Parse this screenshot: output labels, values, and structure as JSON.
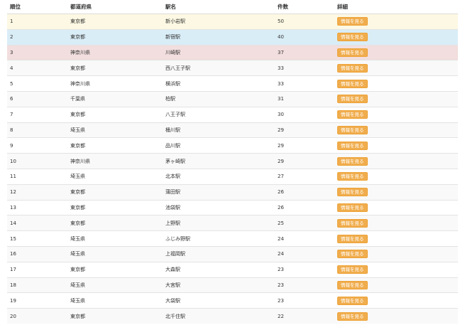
{
  "headers": {
    "rank": "順位",
    "prefecture": "都道府県",
    "station": "駅名",
    "count": "件数",
    "detail": "詳細"
  },
  "button_label": "情報を見る",
  "colors": {
    "rank1_bg": "#fcf8e3",
    "rank2_bg": "#d9edf7",
    "rank3_bg": "#f2dede",
    "button_bg": "#f0ad4e"
  },
  "rows": [
    {
      "rank": "1",
      "prefecture": "東京都",
      "station": "新小岩駅",
      "count": "50"
    },
    {
      "rank": "2",
      "prefecture": "東京都",
      "station": "新宿駅",
      "count": "40"
    },
    {
      "rank": "3",
      "prefecture": "神奈川県",
      "station": "川崎駅",
      "count": "37"
    },
    {
      "rank": "4",
      "prefecture": "東京都",
      "station": "西八王子駅",
      "count": "33"
    },
    {
      "rank": "5",
      "prefecture": "神奈川県",
      "station": "横浜駅",
      "count": "33"
    },
    {
      "rank": "6",
      "prefecture": "千葉県",
      "station": "柏駅",
      "count": "31"
    },
    {
      "rank": "7",
      "prefecture": "東京都",
      "station": "八王子駅",
      "count": "30"
    },
    {
      "rank": "8",
      "prefecture": "埼玉県",
      "station": "桶川駅",
      "count": "29"
    },
    {
      "rank": "9",
      "prefecture": "東京都",
      "station": "品川駅",
      "count": "29"
    },
    {
      "rank": "10",
      "prefecture": "神奈川県",
      "station": "茅ヶ崎駅",
      "count": "29"
    },
    {
      "rank": "11",
      "prefecture": "埼玉県",
      "station": "北本駅",
      "count": "27"
    },
    {
      "rank": "12",
      "prefecture": "東京都",
      "station": "蒲田駅",
      "count": "26"
    },
    {
      "rank": "13",
      "prefecture": "東京都",
      "station": "池袋駅",
      "count": "26"
    },
    {
      "rank": "14",
      "prefecture": "東京都",
      "station": "上野駅",
      "count": "25"
    },
    {
      "rank": "15",
      "prefecture": "埼玉県",
      "station": "ふじみ野駅",
      "count": "24"
    },
    {
      "rank": "16",
      "prefecture": "埼玉県",
      "station": "上福岡駅",
      "count": "24"
    },
    {
      "rank": "17",
      "prefecture": "東京都",
      "station": "大森駅",
      "count": "23"
    },
    {
      "rank": "18",
      "prefecture": "埼玉県",
      "station": "大宮駅",
      "count": "23"
    },
    {
      "rank": "19",
      "prefecture": "埼玉県",
      "station": "大袋駅",
      "count": "23"
    },
    {
      "rank": "20",
      "prefecture": "東京都",
      "station": "北千住駅",
      "count": "22"
    }
  ]
}
